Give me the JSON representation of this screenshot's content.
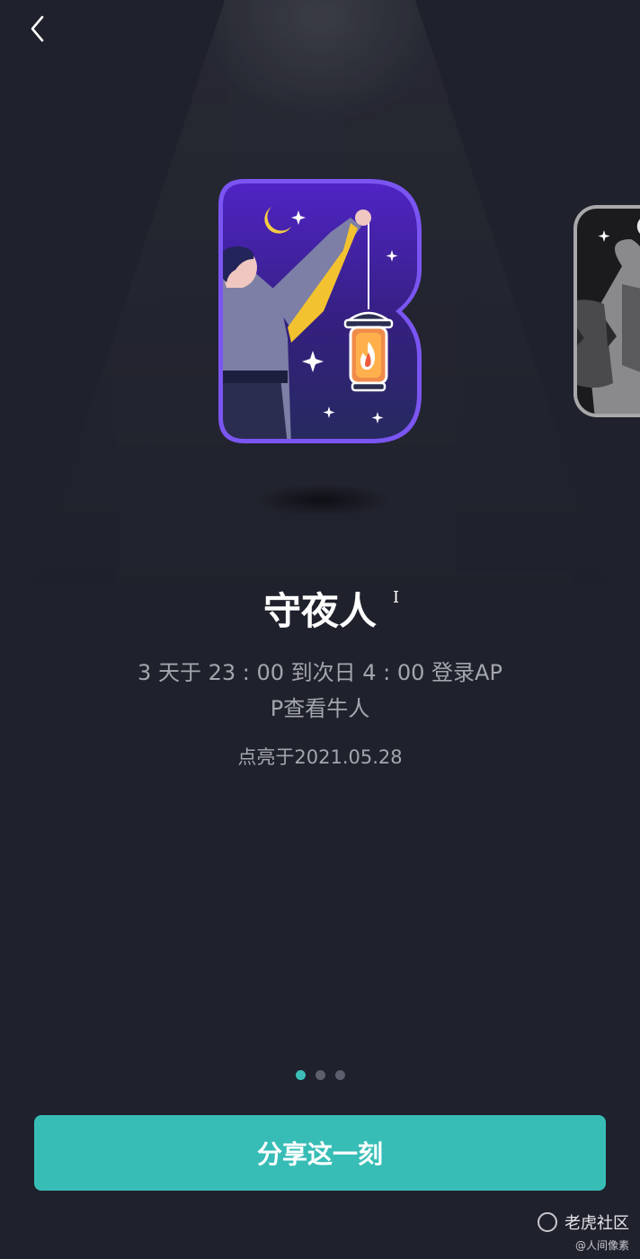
{
  "badge": {
    "title": "守夜人",
    "description": "3 天于 23 : 00 到次日 4 : 00 登录APP查看牛人",
    "lit_date": "点亮于2021.05.28"
  },
  "pager": {
    "count": 3,
    "active_index": 0
  },
  "actions": {
    "share_label": "分享这一刻"
  },
  "watermark": {
    "brand": "老虎社区",
    "credit": "@人间像素"
  },
  "icons": {
    "back": "chevron-left-icon",
    "badge_main": "night-watchman-badge",
    "badge_next": "next-badge-preview"
  },
  "colors": {
    "background": "#1f212c",
    "accent": "#37bdb6",
    "badge_frame": "#7b55f2",
    "badge_sky": "#3d1f9b"
  }
}
